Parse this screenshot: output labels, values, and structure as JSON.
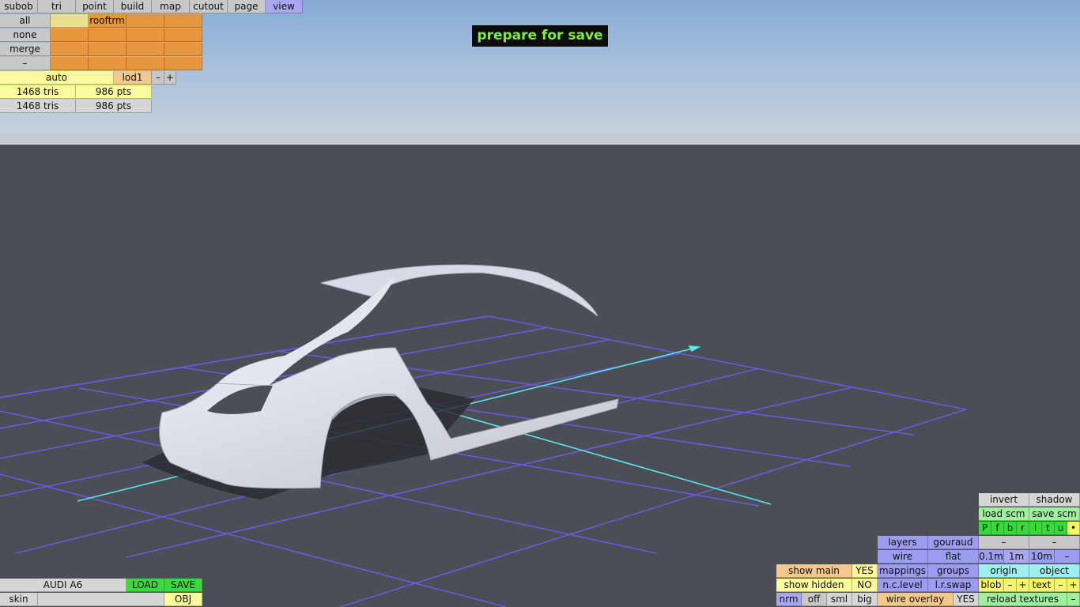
{
  "banner": "prepare for save",
  "menu": [
    "subob",
    "tri",
    "point",
    "build",
    "map",
    "cutout",
    "page",
    "view"
  ],
  "subob_panel": {
    "side": [
      "all",
      "none",
      "merge",
      "–"
    ],
    "grid_label": "rooftrm"
  },
  "lod": {
    "mode": "auto",
    "level": "lod1",
    "minus": "–",
    "plus": "+"
  },
  "stats": [
    {
      "tris": "1468 tris",
      "pts": "986 pts"
    },
    {
      "tris": "1468 tris",
      "pts": "986 pts"
    }
  ],
  "file": {
    "name": "AUDI A6",
    "load": "LOAD",
    "save": "SAVE",
    "skin": "skin",
    "obj": "OBJ"
  },
  "view_panel": {
    "invert": "invert",
    "shadow": "shadow",
    "load_scm": "load scm",
    "save_scm": "save scm",
    "letters": [
      "P",
      "f",
      "b",
      "r",
      "l",
      "t",
      "u",
      "•"
    ],
    "layers": "layers",
    "gouraud": "gouraud",
    "dash1": "–",
    "dash2": "–",
    "wire": "wire",
    "flat": "flat",
    "s01": "0.1m",
    "s1": "1m",
    "s10": "10m",
    "sdash": "–",
    "show_main": "show main",
    "show_main_val": "YES",
    "mappings": "mappings",
    "groups": "groups",
    "origin": "origin",
    "object": "object",
    "show_hidden": "show hidden",
    "show_hidden_val": "NO",
    "nc_level": "n.c.level",
    "lr_swap": "l.r.swap",
    "blob": "blob",
    "blob_minus": "–",
    "blob_plus": "+",
    "text": "text",
    "text_minus": "–",
    "text_plus": "+",
    "nrm": "nrm",
    "off": "off",
    "sml": "sml",
    "big": "big",
    "wire_overlay": "wire overlay",
    "wire_overlay_val": "YES",
    "reload": "reload textures",
    "reload_minus": "–"
  },
  "colors": {
    "sky_top": "#8fb1d9",
    "sky_bottom": "#c5d3de",
    "ground": "#4c4e55",
    "grid": "#6a5cf0",
    "axis": "#58e6e6",
    "model": "#d4d5e0",
    "banner_text": "#7ef03a"
  }
}
